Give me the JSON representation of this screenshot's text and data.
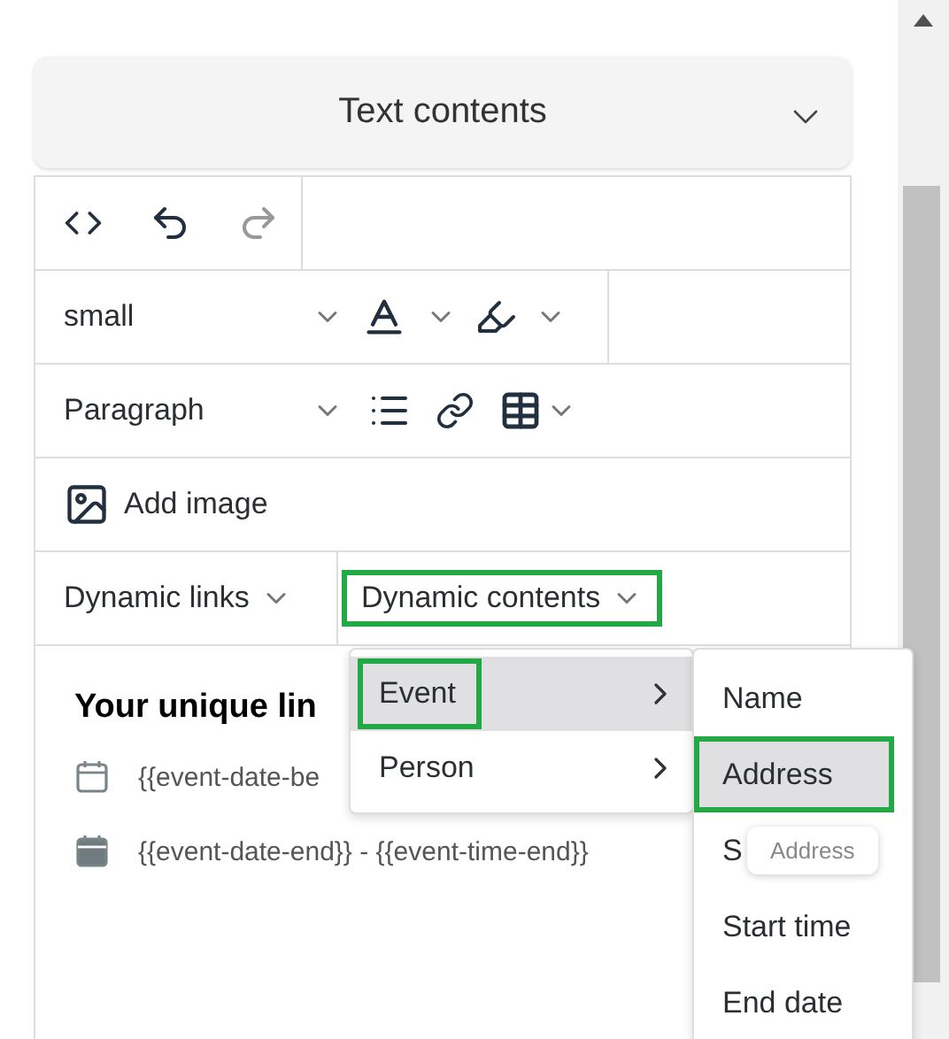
{
  "panel": {
    "title": "Text contents"
  },
  "toolbar": {
    "undo": {
      "disabled": false
    },
    "redo": {
      "disabled": true
    },
    "font_size": "small",
    "block_format": "Paragraph",
    "add_image": "Add image",
    "dynamic_links": "Dynamic links",
    "dynamic_contents": {
      "label": "Dynamic contents",
      "highlighted": true
    }
  },
  "content": {
    "heading": "Your unique lin",
    "lines": [
      {
        "text": "{{event-date-be",
        "kind": "outline"
      },
      {
        "text": "{{event-date-end}} - {{event-time-end}}",
        "kind": "filled"
      }
    ]
  },
  "menu": {
    "items": [
      {
        "label": "Event",
        "selected": true,
        "highlighted": true
      },
      {
        "label": "Person",
        "selected": false,
        "highlighted": false
      }
    ]
  },
  "submenu": {
    "items": [
      {
        "label": "Name",
        "selected": false,
        "highlighted": false
      },
      {
        "label": "Address",
        "selected": true,
        "highlighted": true
      },
      {
        "label": "S",
        "selected": false,
        "highlighted": false
      },
      {
        "label": "Start time",
        "selected": false,
        "highlighted": false
      },
      {
        "label": "End date",
        "selected": false,
        "highlighted": false
      }
    ]
  },
  "tooltip": "Address"
}
